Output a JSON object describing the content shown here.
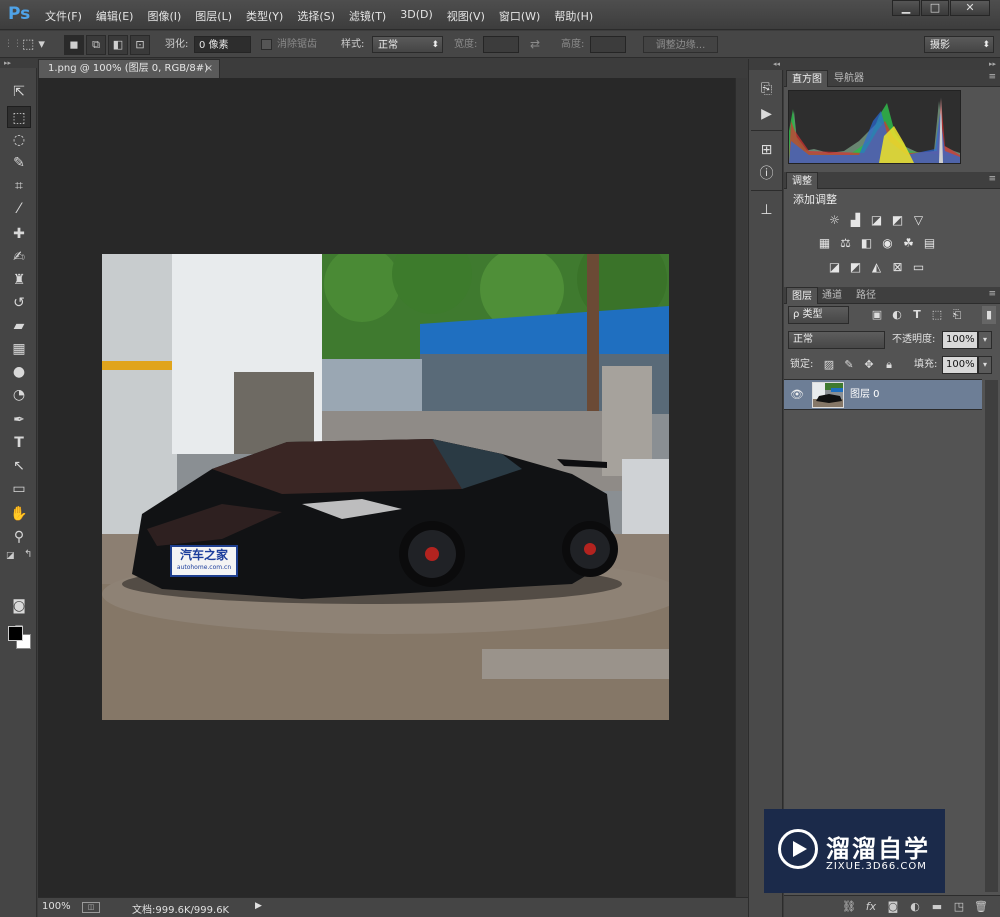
{
  "app": {
    "logo": "Ps"
  },
  "menubar": {
    "items": [
      "文件(F)",
      "编辑(E)",
      "图像(I)",
      "图层(L)",
      "类型(Y)",
      "选择(S)",
      "滤镜(T)",
      "3D(D)",
      "视图(V)",
      "窗口(W)",
      "帮助(H)"
    ],
    "window_controls": [
      "▁",
      "□",
      "✕"
    ]
  },
  "options": {
    "feather_label": "羽化:",
    "feather_value": "0 像素",
    "antialias_label": "消除锯齿",
    "style_label": "样式:",
    "style_value": "正常",
    "width_label": "宽度:",
    "height_label": "高度:",
    "refine_edge": "调整边缘...",
    "workspace": "摄影"
  },
  "document": {
    "tab_title": "1.png @ 100% (图层 0, RGB/8#)",
    "close_glyph": "×"
  },
  "photo": {
    "plate_brand": "汽车之家",
    "plate_url": "autohome.com.cn"
  },
  "status": {
    "zoom": "100%",
    "doc_info": "文档:999.6K/999.6K",
    "arrow": "▶"
  },
  "panels": {
    "histogram_tabs": [
      "直方图",
      "导航器"
    ],
    "adjustments_tab": "调整",
    "adjustments_title": "添加调整",
    "layers_tabs": [
      "图层",
      "通道",
      "路径"
    ],
    "layer_filter": "ρ 类型",
    "blend_mode": "正常",
    "opacity_label": "不透明度:",
    "opacity_value": "100%",
    "lock_label": "锁定:",
    "fill_label": "填充:",
    "fill_value": "100%",
    "layer_name": "图层 0"
  },
  "watermark": {
    "title": "溜溜自学",
    "subtitle": "ZIXUE.3D66.COM"
  },
  "colors": {
    "accent": "#4fa3e8",
    "selected_layer": "#6d7e96"
  }
}
